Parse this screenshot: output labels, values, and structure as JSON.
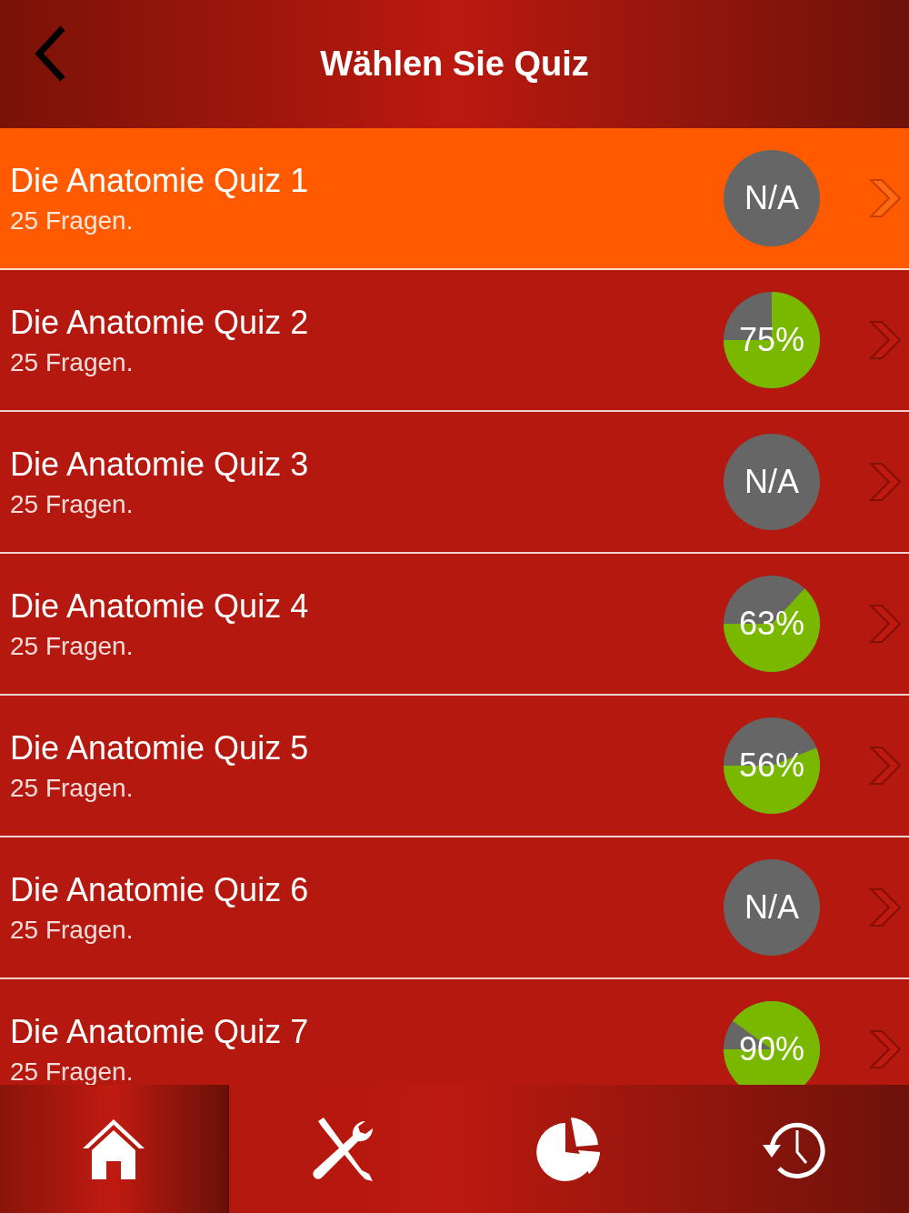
{
  "header": {
    "title": "Wählen Sie Quiz"
  },
  "quizzes": [
    {
      "title": "Die Anatomie Quiz 1",
      "subtitle": "25 Fragen.",
      "score": "N/A",
      "kind": "empty",
      "selected": true
    },
    {
      "title": "Die Anatomie Quiz 2",
      "subtitle": "25 Fragen.",
      "score": "75%",
      "kind": "pie",
      "selected": false
    },
    {
      "title": "Die Anatomie Quiz 3",
      "subtitle": "25 Fragen.",
      "score": "N/A",
      "kind": "empty",
      "selected": false
    },
    {
      "title": "Die Anatomie Quiz 4",
      "subtitle": "25 Fragen.",
      "score": "63%",
      "kind": "pie",
      "selected": false
    },
    {
      "title": "Die Anatomie Quiz 5",
      "subtitle": "25 Fragen.",
      "score": "56%",
      "kind": "pie",
      "selected": false
    },
    {
      "title": "Die Anatomie Quiz 6",
      "subtitle": "25 Fragen.",
      "score": "N/A",
      "kind": "empty",
      "selected": false
    },
    {
      "title": "Die Anatomie Quiz 7",
      "subtitle": "25 Fragen.",
      "score": "90%",
      "kind": "pie",
      "selected": false
    }
  ],
  "tab_bar": [
    {
      "selected": true
    },
    {
      "selected": false
    },
    {
      "selected": false
    },
    {
      "selected": false
    }
  ]
}
